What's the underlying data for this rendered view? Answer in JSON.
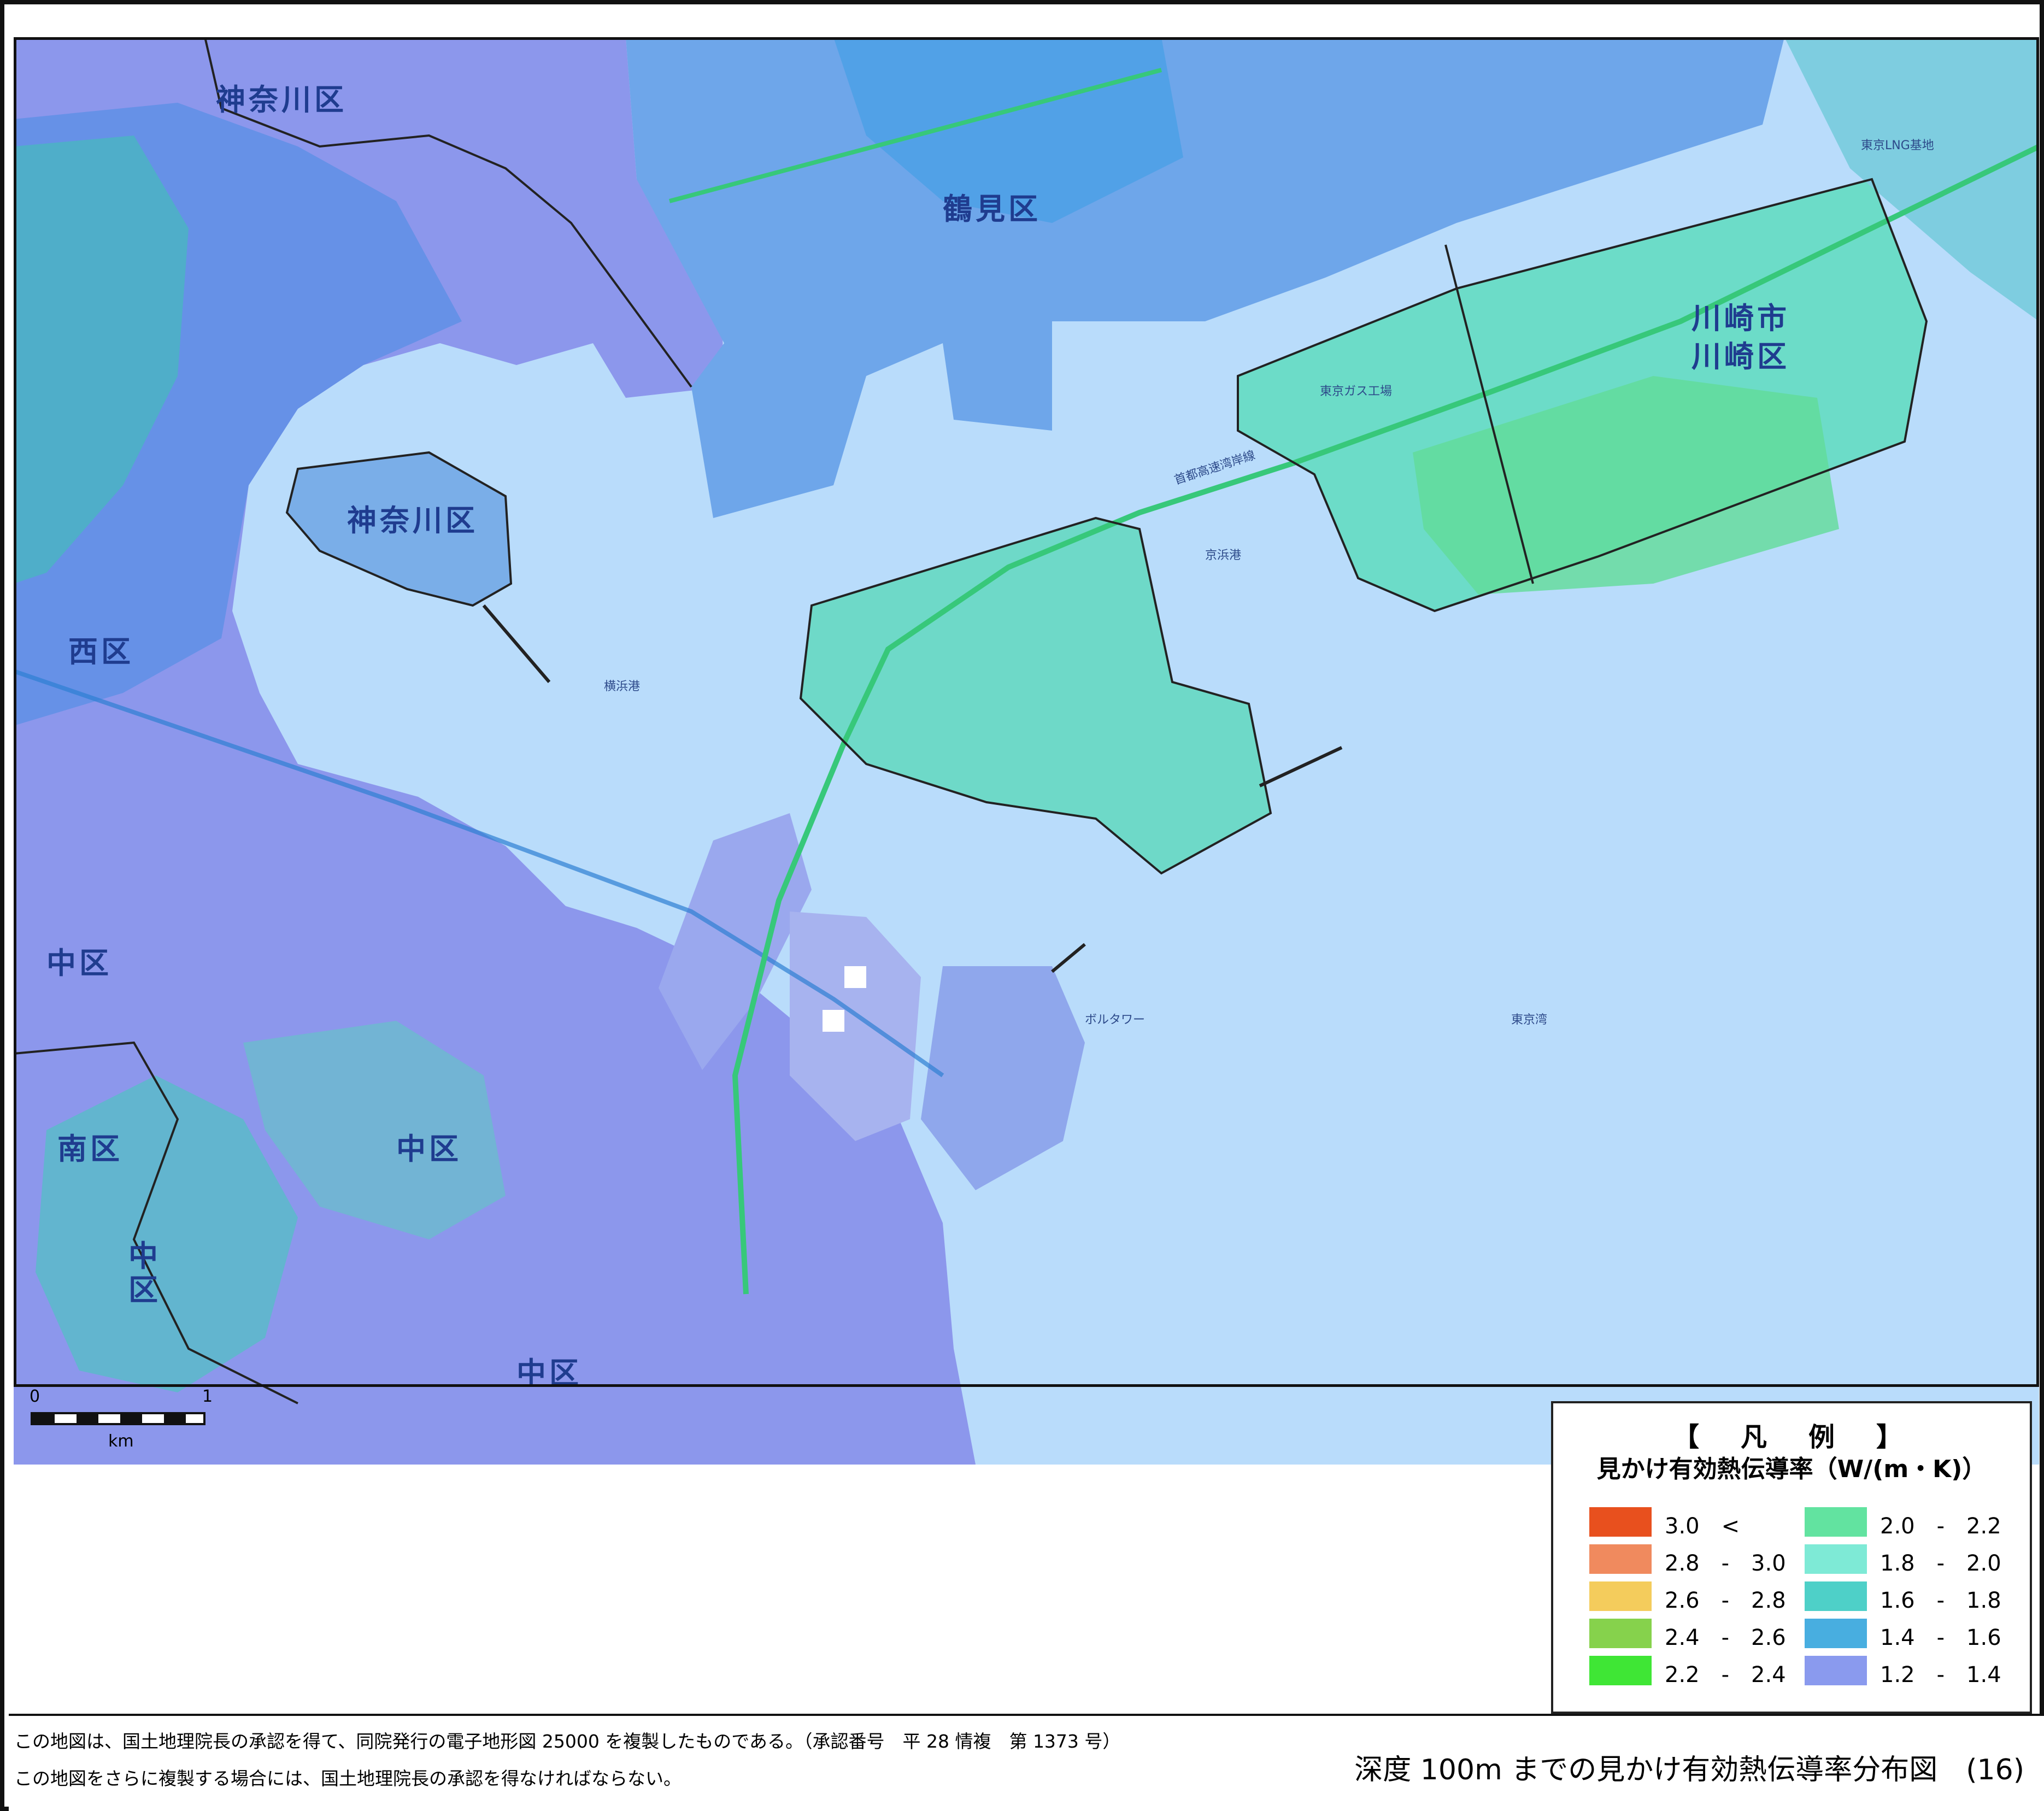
{
  "map": {
    "labels": {
      "kanagawa_ku_top": "神奈川区",
      "tsurumi_ku": "鶴見区",
      "kawasaki_city": "川崎市",
      "kawasaki_ku": "川崎区",
      "kanagawa_ku_port": "神奈川区",
      "nishi_ku": "西区",
      "naka_ku_left": "中区",
      "minami_ku": "南区",
      "naka_ku_center": "中区",
      "naka_ku_lower": "中区",
      "naka_ku_bottom": "中区"
    },
    "small_labels": {
      "yokohama_port": "横浜港",
      "keihin_port": "京浜港",
      "tokyo_bay": "東京湾",
      "tokyo_gas": "東京ガス工場",
      "tokyo_lng": "東京LNG基地",
      "bay_tower": "ボルタワー",
      "shuto_expressway": "首都高速湾岸線"
    }
  },
  "scale_bar": {
    "tick_start": "0",
    "tick_end": "1",
    "unit": "km"
  },
  "legend": {
    "title": "【　凡　例　】",
    "subtitle": "見かけ有効熱伝導率（W/(m・K)）",
    "items": [
      {
        "label": "3.0　<",
        "color": "#e8501e"
      },
      {
        "label": "2.8　-　3.0",
        "color": "#f08a5e"
      },
      {
        "label": "2.6　-　2.8",
        "color": "#f4cc5c"
      },
      {
        "label": "2.4　-　2.6",
        "color": "#86d24c"
      },
      {
        "label": "2.2　-　2.4",
        "color": "#3fe635"
      },
      {
        "label": "2.0　-　2.2",
        "color": "#62e3a0"
      },
      {
        "label": "1.8　-　2.0",
        "color": "#7eead6"
      },
      {
        "label": "1.6　-　1.8",
        "color": "#4ed0c8"
      },
      {
        "label": "1.4　-　1.6",
        "color": "#48aee0"
      },
      {
        "label": "1.2　-　1.4",
        "color": "#8a9aee"
      }
    ]
  },
  "footer": {
    "credit_line1": "この地図は、国土地理院長の承認を得て、同院発行の電子地形図 25000 を複製したものである。（承認番号　平 28 情複　第 1373 号）",
    "credit_line2": "この地図をさらに複製する場合には、国土地理院長の承認を得なければならない。",
    "map_title": "深度 100m までの見かけ有効熱伝導率分布図　(16)"
  },
  "colors": {
    "sea": "#b9dcfb",
    "land_low": "#8a9aee",
    "land_mid": "#48aee0",
    "land_high": "#62e3a0"
  }
}
